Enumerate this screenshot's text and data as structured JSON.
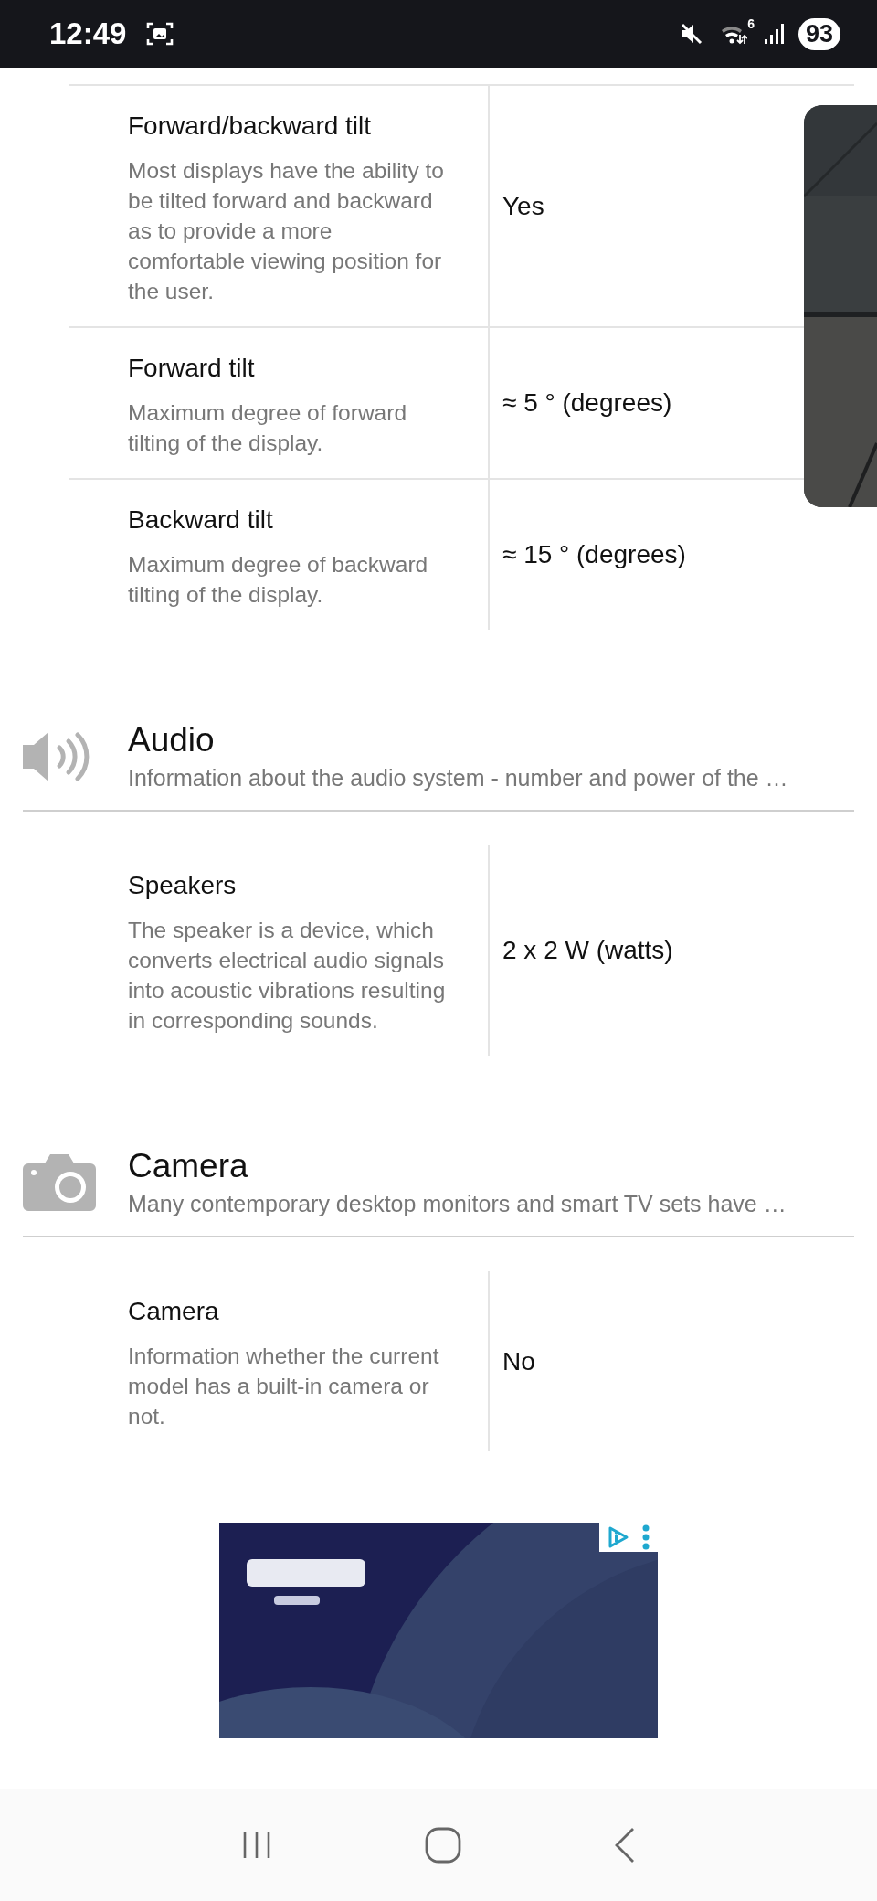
{
  "status_bar": {
    "time": "12:49",
    "wifi_badge": "6",
    "battery": "93"
  },
  "sections": [
    {
      "kind": "plain",
      "rows": [
        {
          "title": "Forward/backward tilt",
          "description": "Most displays have the ability to be tilted forward and backward as to provide a more comfortable viewing position for the user.",
          "value": "Yes"
        },
        {
          "title": "Forward tilt",
          "description": "Maximum degree of forward tilting of the display.",
          "value": "≈ 5 ° (degrees)"
        },
        {
          "title": "Backward tilt",
          "description": "Maximum degree of backward tilting of the display.",
          "value": "≈ 15 ° (degrees)"
        }
      ]
    },
    {
      "kind": "audio",
      "title": "Audio",
      "description": "Information about the audio system - number and power of the …",
      "rows": [
        {
          "title": "Speakers",
          "description": "The speaker is a device, which converts electrical audio signals into acoustic vibrations resulting in corresponding sounds.",
          "value": "2 x 2 W (watts)"
        }
      ]
    },
    {
      "kind": "camera",
      "title": "Camera",
      "description": "Many contemporary desktop monitors and smart TV sets have …",
      "rows": [
        {
          "title": "Camera",
          "description": "Information whether the current model has a built-in camera or not.",
          "value": "No"
        }
      ]
    }
  ]
}
